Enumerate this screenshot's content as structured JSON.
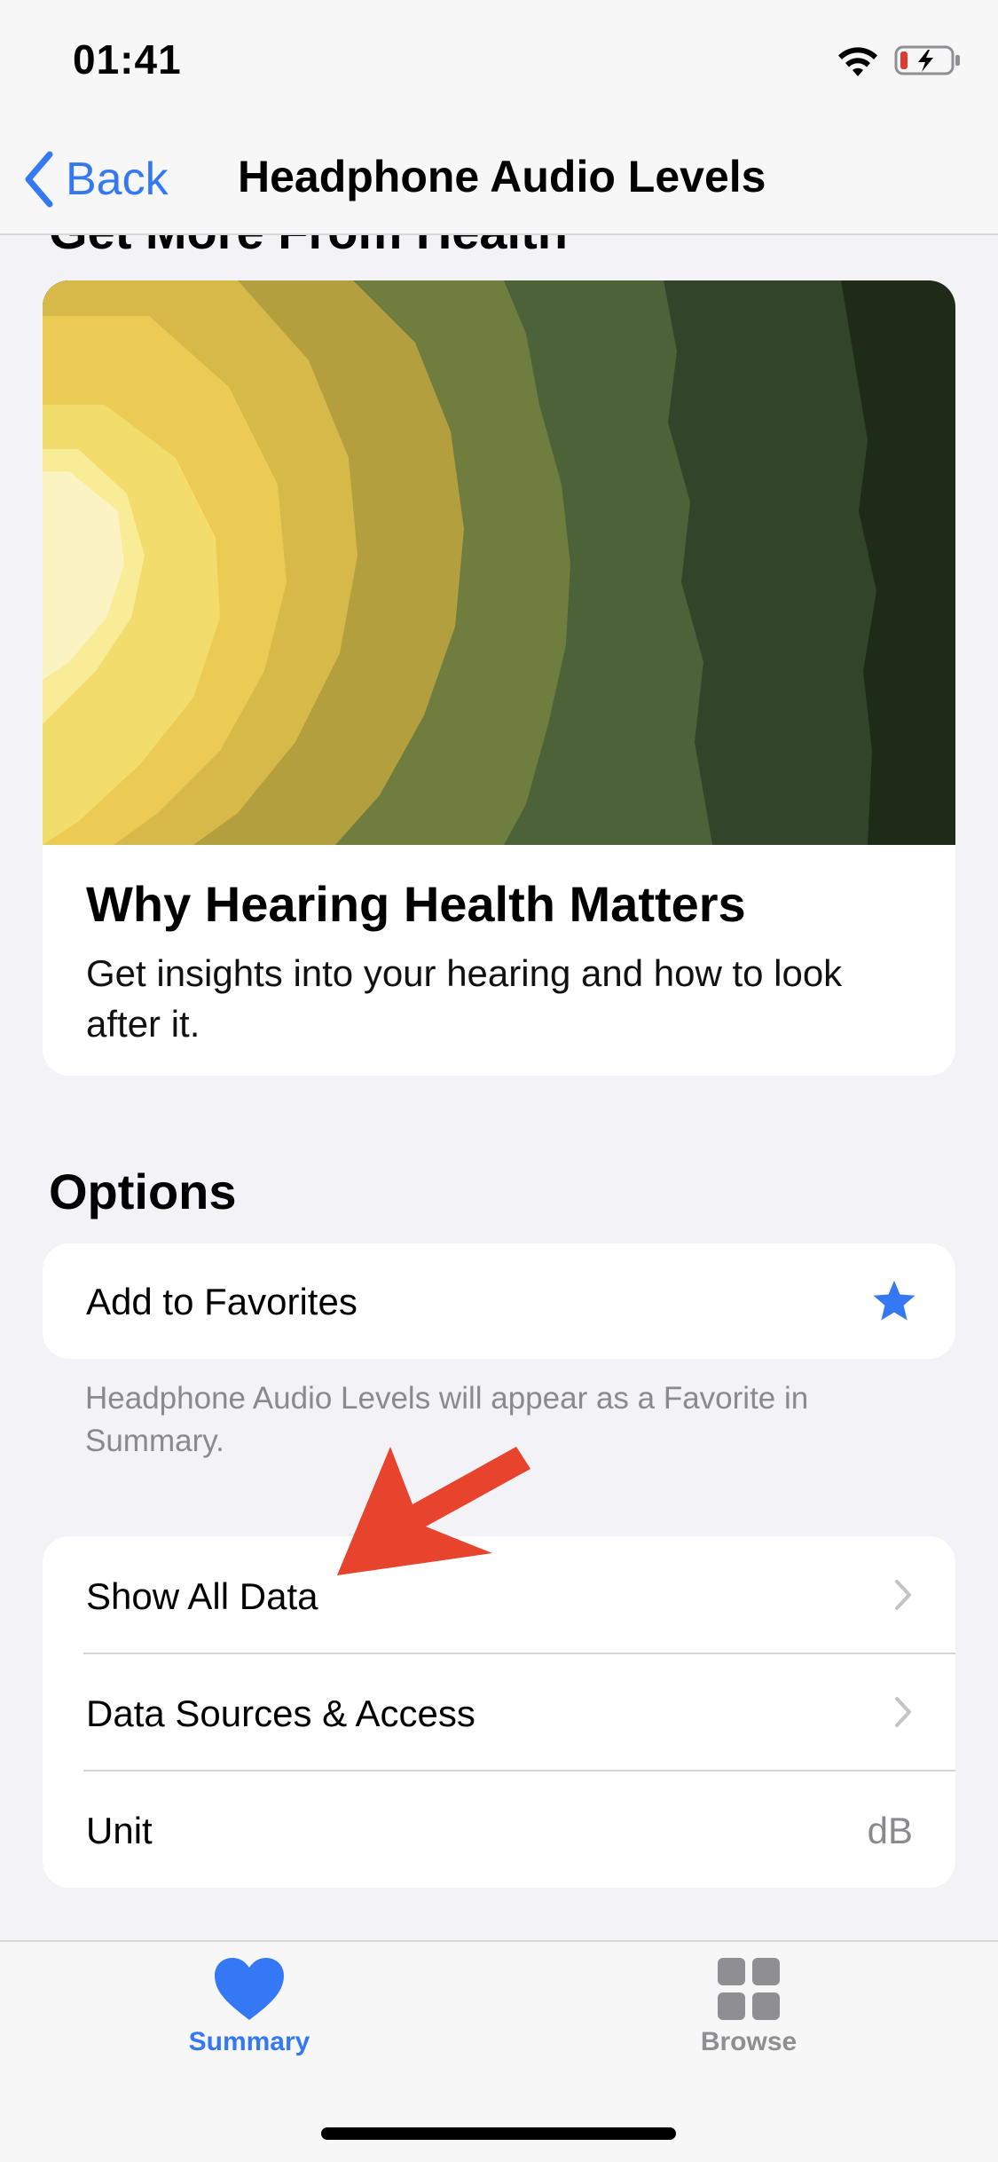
{
  "status_bar": {
    "time": "01:41",
    "wifi_icon": "wifi-icon",
    "battery_icon": "battery-charging-icon",
    "battery_color": "#e03b31"
  },
  "nav": {
    "back_label": "Back",
    "title": "Headphone Audio Levels",
    "accent_color": "#3478f6"
  },
  "article_section": {
    "heading": "Get More From Health",
    "card": {
      "title": "Why Hearing Health Matters",
      "body": "Get insights into your hearing and how to look after it."
    }
  },
  "options": {
    "heading": "Options",
    "favorites": {
      "label": "Add to Favorites",
      "icon": "star-icon",
      "footnote": "Headphone Audio Levels will appear as a Favorite in Summary."
    },
    "rows": [
      {
        "label": "Show All Data",
        "accessory": "chevron-right-icon"
      },
      {
        "label": "Data Sources & Access",
        "accessory": "chevron-right-icon"
      },
      {
        "label": "Unit",
        "value": "dB"
      }
    ]
  },
  "tab_bar": {
    "tabs": [
      {
        "label": "Summary",
        "icon": "heart-icon",
        "selected": true
      },
      {
        "label": "Browse",
        "icon": "grid-icon",
        "selected": false
      }
    ]
  },
  "annotation": {
    "icon": "red-arrow-icon",
    "color": "#e8432c"
  }
}
